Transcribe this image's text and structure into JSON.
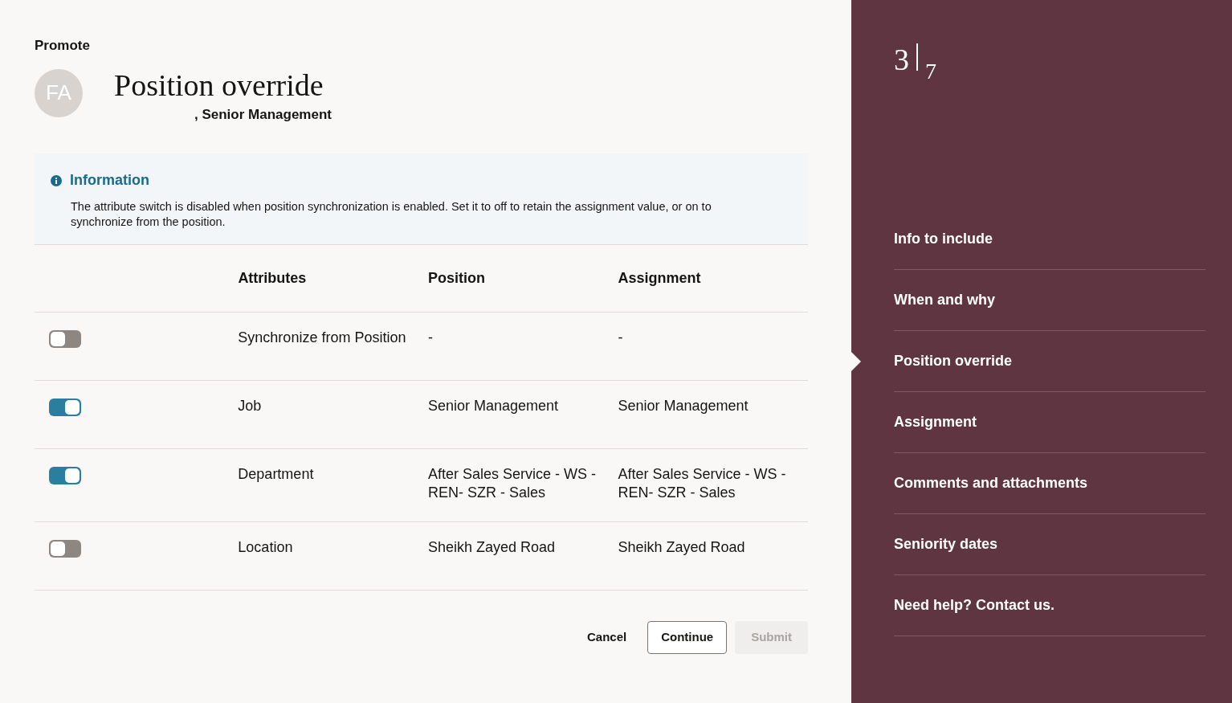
{
  "header": {
    "eyebrow": "Promote",
    "avatar_initials": "FA",
    "title": "Position override",
    "subtitle": ", Senior Management"
  },
  "info": {
    "title": "Information",
    "text": "The attribute switch is disabled when position synchronization is enabled. Set it to off to retain the assignment value, or on to synchronize from the position."
  },
  "table": {
    "columns": [
      "Attributes",
      "Position",
      "Assignment"
    ],
    "rows": [
      {
        "on": false,
        "attribute": "Synchronize from Position",
        "position": "-",
        "assignment": "-"
      },
      {
        "on": true,
        "attribute": "Job",
        "position": "Senior Management",
        "assignment": "Senior Management"
      },
      {
        "on": true,
        "attribute": "Department",
        "position": "After Sales Service - WS - REN- SZR - Sales",
        "assignment": "After Sales Service - WS - REN- SZR - Sales"
      },
      {
        "on": false,
        "attribute": "Location",
        "position": "Sheikh Zayed Road",
        "assignment": "Sheikh Zayed Road"
      }
    ]
  },
  "buttons": [
    {
      "label": "Cancel",
      "kind": "link",
      "disabled": false
    },
    {
      "label": "Continue",
      "kind": "outline",
      "disabled": false
    },
    {
      "label": "Submit",
      "kind": "filled",
      "disabled": true
    }
  ],
  "steps": {
    "current": "3",
    "total": "7",
    "items": [
      {
        "label": "Info to include",
        "selected": false
      },
      {
        "label": "When and why",
        "selected": false
      },
      {
        "label": "Position override",
        "selected": true
      },
      {
        "label": "Assignment",
        "selected": false
      },
      {
        "label": "Comments and attachments",
        "selected": false
      },
      {
        "label": "Seniority dates",
        "selected": false
      },
      {
        "label": "Need help? Contact us.",
        "selected": false
      }
    ]
  }
}
